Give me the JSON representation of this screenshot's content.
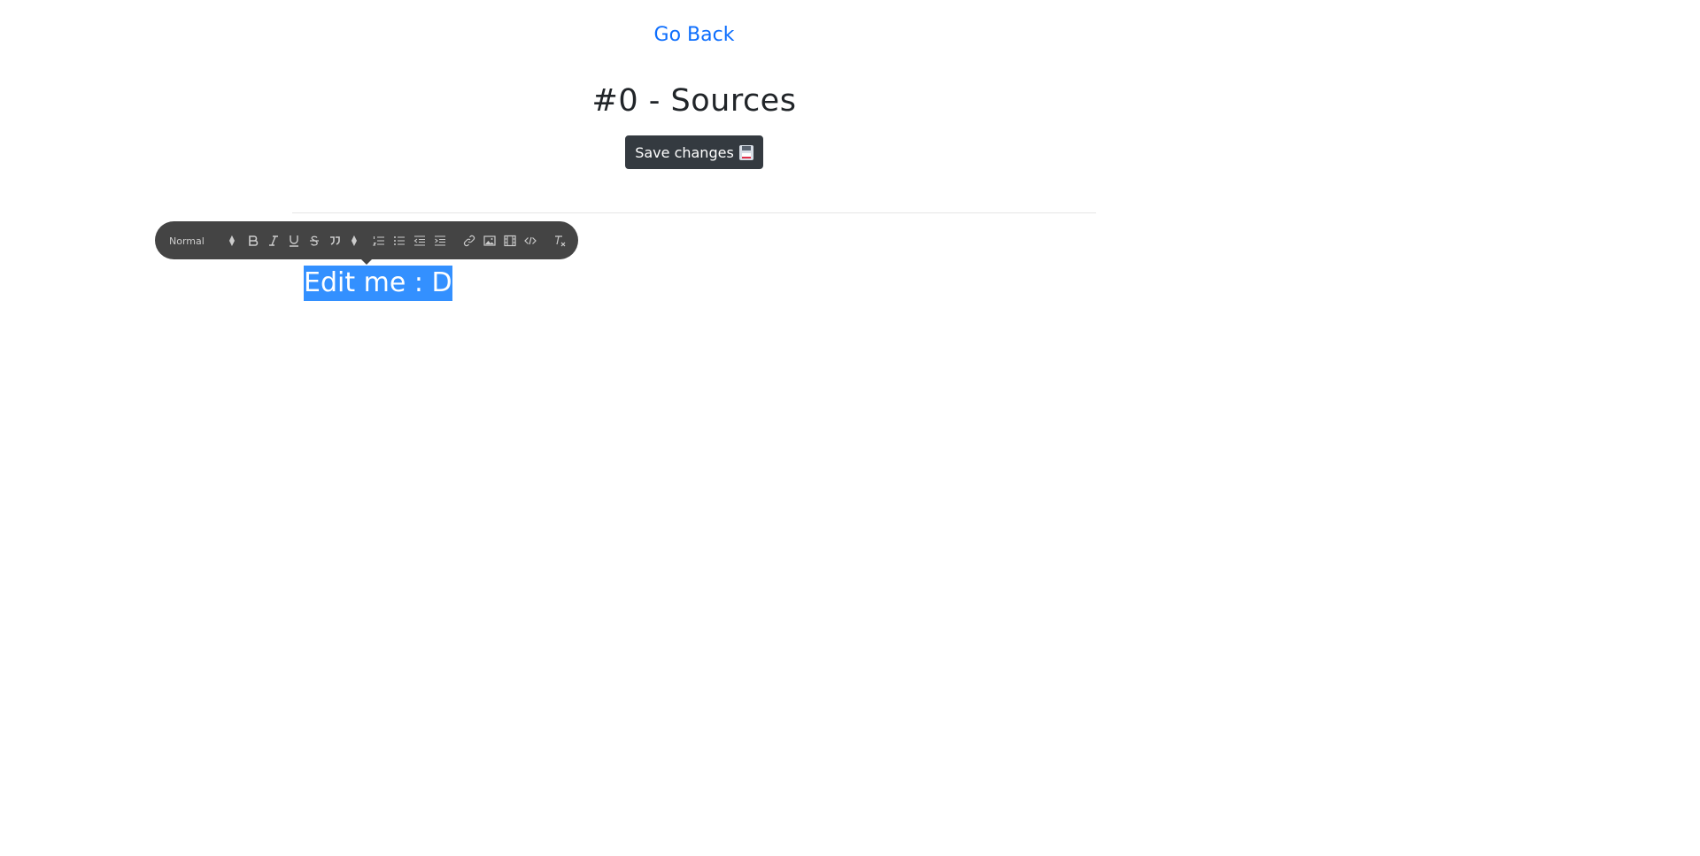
{
  "nav": {
    "go_back": "Go Back"
  },
  "header": {
    "title": "#0 - Sources"
  },
  "actions": {
    "save_label": "Save changes",
    "save_icon": "floppy-disk-icon"
  },
  "toolbar": {
    "header_select_value": "Normal",
    "buttons": [
      "bold",
      "italic",
      "underline",
      "strike",
      "blockquote",
      "script-select",
      "ordered-list",
      "bullet-list",
      "outdent",
      "indent",
      "link",
      "image",
      "video",
      "code-block",
      "clean"
    ]
  },
  "editor": {
    "content": "Edit me : D"
  },
  "colors": {
    "link": "#0d6efd",
    "button_bg": "#343a40",
    "toolbar_bg": "#444444",
    "selection": "#3390ff"
  }
}
